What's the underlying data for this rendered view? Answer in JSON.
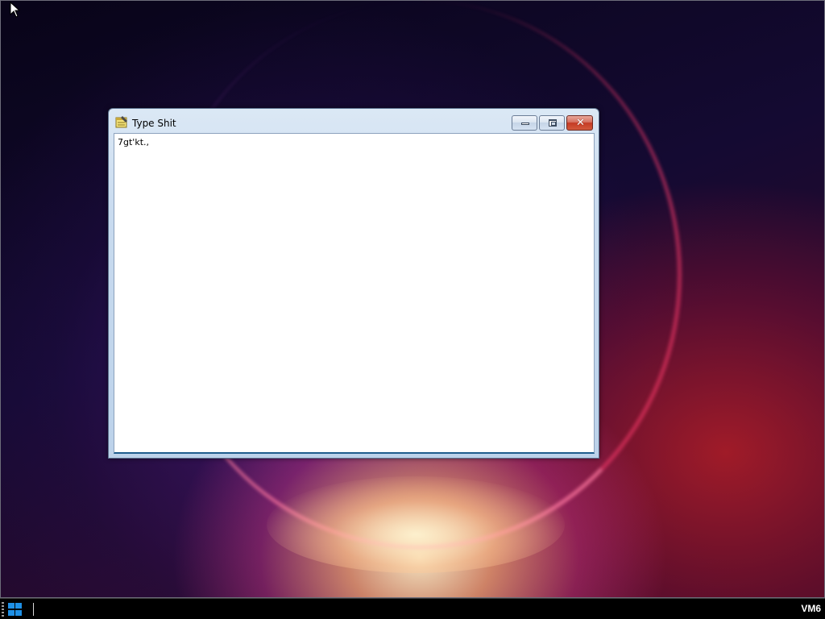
{
  "window": {
    "title": "Type Shit",
    "content": "7gt'kt.,",
    "icon": "notepad-icon",
    "buttons": {
      "minimize": "minimize-icon",
      "maximize": "maximize-icon",
      "close": "close-icon"
    }
  },
  "taskbar": {
    "start_icon": "windows-logo-icon",
    "machine_label": "VM6"
  },
  "colors": {
    "close_button": "#c43a24",
    "start_logo": "#1e90e6",
    "taskbar": "#000000"
  }
}
